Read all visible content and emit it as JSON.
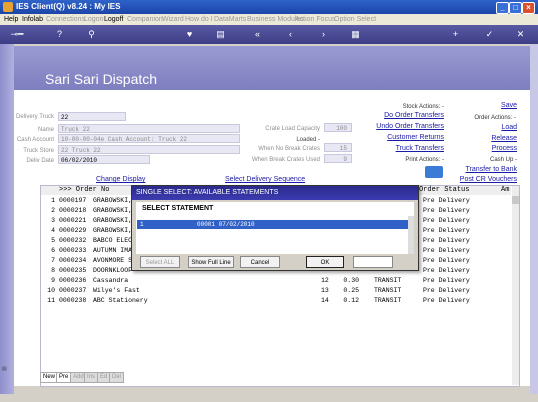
{
  "window": {
    "title": "IES Client(Q) v8.24 : My IES",
    "colors": {
      "titlebar": "#2f63c9",
      "header": "#8a8acb"
    }
  },
  "menu": {
    "items": [
      "Help",
      "Infolab",
      "Connections",
      "Logon",
      "Logoff",
      "Companion",
      "Wizard",
      "How do I",
      "DataMarts",
      "Business Modules",
      "Action Focus",
      "Option Select"
    ]
  },
  "page": {
    "title": "Sari Sari Dispatch"
  },
  "form": {
    "delivery_truck": {
      "label": "Delivery Truck",
      "value": "22"
    },
    "name": {
      "label": "Name",
      "value": "Truck 22"
    },
    "cash_account": {
      "label": "Cash Account",
      "value": "10-00-00-04e Cash Account: Truck 22"
    },
    "truck_store": {
      "label": "Truck Store",
      "value": "22 Truck 22"
    },
    "deliv_date": {
      "label": "Deliv Date",
      "value": "06/02/2010"
    },
    "crate_load_capacity": {
      "label": "Crate Load Capacity",
      "value": "100"
    },
    "loaded": {
      "label": "Loaded -",
      "value": ""
    },
    "when_no_break_crates": {
      "label": "When No Break Crates",
      "value": "15"
    },
    "when_break_crates_used": {
      "label": "When Break Crates Used",
      "value": "9"
    }
  },
  "links": {
    "change_display": "Change Display",
    "select_delivery_sequence": "Select Delivery Sequence"
  },
  "stock_actions": {
    "label": "Stock Actions: -",
    "items": [
      "Do Order Transfers",
      "Undo Order Transfers",
      "Customer Returns",
      "Truck Transfers"
    ]
  },
  "order_actions": {
    "label": "Order Actions: -",
    "items": [
      "Save",
      "Load",
      "Release",
      "Process"
    ]
  },
  "print_actions": {
    "label": "Print Actions: -"
  },
  "cash_actions": {
    "label": "Cash Up -",
    "items": [
      "Transfer to Bank",
      "Post CR Vouchers"
    ]
  },
  "grid": {
    "columns": [
      ">>> Order No",
      "Order Status",
      "Am"
    ],
    "rows": [
      {
        "n": "1",
        "order": "0000197",
        "cust": "GRABOWSKI,",
        "a": "",
        "b": "",
        "c": "",
        "status": "Pre Delivery"
      },
      {
        "n": "2",
        "order": "0000218",
        "cust": "GRABOWSKI,",
        "a": "",
        "b": "",
        "c": "",
        "status": "Pre Delivery"
      },
      {
        "n": "3",
        "order": "0000221",
        "cust": "GRABOWSKI,",
        "a": "",
        "b": "",
        "c": "",
        "status": "Pre Delivery"
      },
      {
        "n": "4",
        "order": "0000229",
        "cust": "GRABOWSKI,",
        "a": "",
        "b": "",
        "c": "",
        "status": "Pre Delivery"
      },
      {
        "n": "5",
        "order": "0000232",
        "cust": "BABCO ELECT",
        "a": "",
        "b": "",
        "c": "",
        "status": "Pre Delivery"
      },
      {
        "n": "6",
        "order": "0000233",
        "cust": "AUTUMN IMAG",
        "a": "",
        "b": "",
        "c": "",
        "status": "Pre Delivery"
      },
      {
        "n": "7",
        "order": "0000234",
        "cust": "AVONMORE SC",
        "a": "",
        "b": "",
        "c": "",
        "status": "Pre Delivery"
      },
      {
        "n": "8",
        "order": "0000235",
        "cust": "DOORNKLOOF",
        "a": "",
        "b": "",
        "c": "",
        "status": "Pre Delivery"
      },
      {
        "n": "9",
        "order": "0000236",
        "cust": "Cassandra",
        "a": "12",
        "b": "0.30",
        "c": "TRANSIT",
        "status": "Pre Delivery"
      },
      {
        "n": "10",
        "order": "0000237",
        "cust": "Wilye's Fast",
        "a": "13",
        "b": "0.25",
        "c": "TRANSIT",
        "status": "Pre Delivery"
      },
      {
        "n": "11",
        "order": "0000238",
        "cust": "ABC Stationery",
        "a": "14",
        "b": "0.12",
        "c": "TRANSIT",
        "status": "Pre Delivery"
      }
    ]
  },
  "tabs": [
    "New",
    "Pre",
    "Add",
    "Ins",
    "Ed",
    "Del"
  ],
  "dialog": {
    "title": "SINGLE SELECT: AVAILABLE STATEMENTS",
    "heading": "SELECT STATEMENT",
    "selected_row": {
      "n": "1",
      "text": "00001 07/02/2010"
    },
    "buttons": {
      "select_all": "Select ALL",
      "show_full_line": "Show Full Line",
      "cancel": "Cancel",
      "ok": "OK"
    }
  }
}
